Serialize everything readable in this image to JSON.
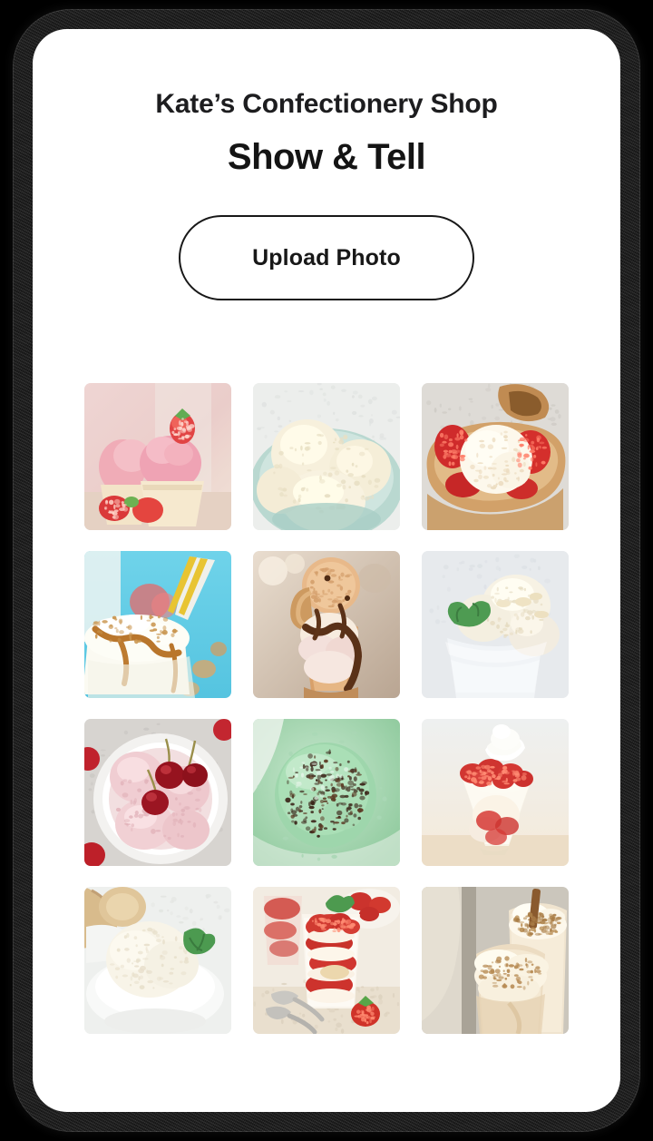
{
  "app": {
    "frame": "smartphone-mockup",
    "screen_background": "#ffffff",
    "accent_color": "#181818"
  },
  "header": {
    "brand_title": "Kate’s Confectionery Shop",
    "page_title": "Show & Tell"
  },
  "actions": {
    "upload_label": "Upload Photo"
  },
  "gallery": {
    "columns": 3,
    "rows": 4,
    "photos": [
      {
        "id": 1,
        "name": "strawberry-cupcakes",
        "alt": "Pink frosted strawberry cupcakes with fresh strawberries"
      },
      {
        "id": 2,
        "name": "vanilla-scoops-mint-bowl",
        "alt": "Scoops of vanilla ice cream in a mint green bowl"
      },
      {
        "id": 3,
        "name": "strawberry-waffle-bowl",
        "alt": "Vanilla scoop with strawberries in a waffle bowl"
      },
      {
        "id": 4,
        "name": "caramel-nut-milkshake",
        "alt": "Caramel nut milkshake with yellow striped straw on blue"
      },
      {
        "id": 5,
        "name": "chocolate-sundae-cone",
        "alt": "Chocolate drizzled sundae in waffle cone with wafer"
      },
      {
        "id": 6,
        "name": "vanilla-almond-mint-glass",
        "alt": "Vanilla scoops with almond flakes and mint in a glass"
      },
      {
        "id": 7,
        "name": "cherry-ice-cream-bowl",
        "alt": "Pink cherry ice cream scoops in a white bowl with cherries"
      },
      {
        "id": 8,
        "name": "mint-chocolate-chip-scoop",
        "alt": "Mint chocolate chip ice cream scoop"
      },
      {
        "id": 9,
        "name": "strawberry-parfait-glass",
        "alt": "Strawberry parfait with whipped cream in a martini glass"
      },
      {
        "id": 10,
        "name": "coconut-ice-cream-bowl",
        "alt": "Coconut ice cream scoop with mint in a white bowl"
      },
      {
        "id": 11,
        "name": "strawberry-trifle-glass",
        "alt": "Layered strawberry trifle in a glass with spoons"
      },
      {
        "id": 12,
        "name": "cinnamon-horchata-shakes",
        "alt": "Whipped cream topped horchata shakes with cinnamon stick"
      }
    ]
  }
}
